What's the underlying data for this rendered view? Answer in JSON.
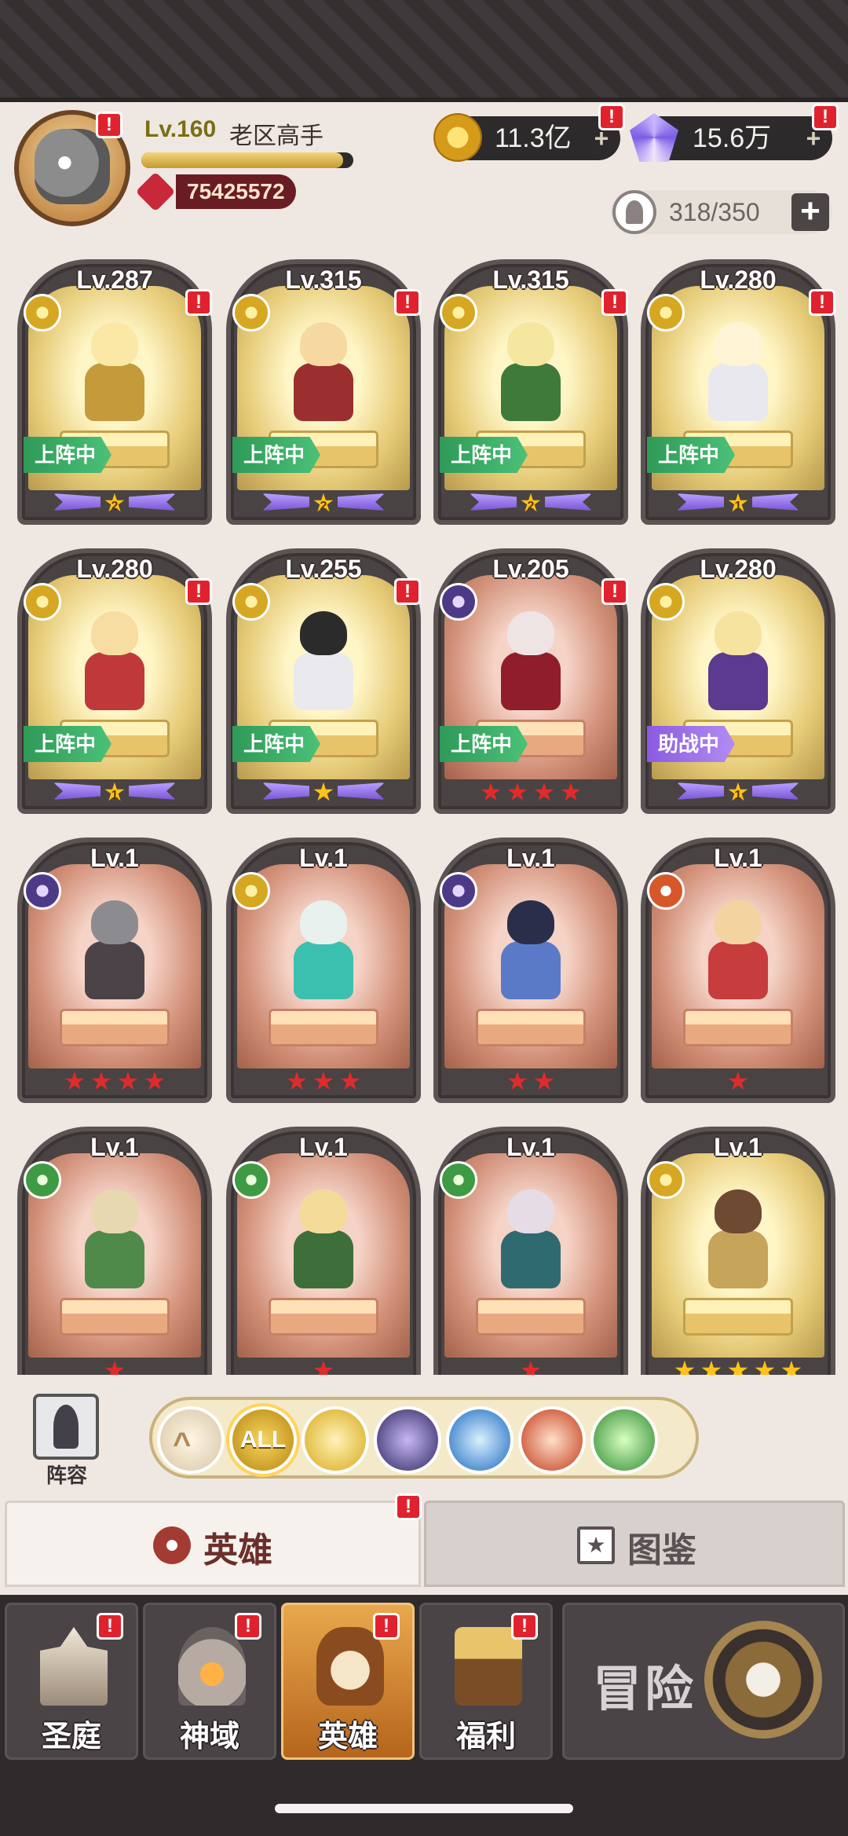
{
  "header": {
    "level": "Lv.160",
    "name": "老区高手",
    "exp_fraction": 0.95,
    "power": "75425572",
    "gold": "11.3亿",
    "gems": "15.6万",
    "capacity": "318/350",
    "avatar_badge": "!",
    "gold_badge": "!",
    "gem_badge": "!"
  },
  "heroes": [
    {
      "level": "Lv.287",
      "faction": "gold",
      "bg": "gold",
      "tag": "上阵中",
      "tag_color": "green",
      "stars": 1,
      "star_num": "2",
      "star_style": "wing",
      "badge": "!"
    },
    {
      "level": "Lv.315",
      "faction": "gold",
      "bg": "gold",
      "tag": "上阵中",
      "tag_color": "green",
      "stars": 1,
      "star_num": "2",
      "star_style": "wing",
      "badge": "!"
    },
    {
      "level": "Lv.315",
      "faction": "gold",
      "bg": "gold",
      "tag": "上阵中",
      "tag_color": "green",
      "stars": 1,
      "star_num": "2",
      "star_style": "wing",
      "badge": "!"
    },
    {
      "level": "Lv.280",
      "faction": "gold",
      "bg": "gold",
      "tag": "上阵中",
      "tag_color": "green",
      "stars": 1,
      "star_num": "1",
      "star_style": "wing",
      "badge": "!"
    },
    {
      "level": "Lv.280",
      "faction": "gold",
      "bg": "gold",
      "tag": "上阵中",
      "tag_color": "green",
      "stars": 1,
      "star_num": "1",
      "star_style": "wing",
      "badge": "!"
    },
    {
      "level": "Lv.255",
      "faction": "gold",
      "bg": "gold",
      "tag": "上阵中",
      "tag_color": "green",
      "stars": 1,
      "star_num": "",
      "star_style": "wing",
      "badge": "!"
    },
    {
      "level": "Lv.205",
      "faction": "dark",
      "bg": "red",
      "tag": "上阵中",
      "tag_color": "green",
      "stars": 4,
      "star_num": "",
      "star_style": "red",
      "badge": "!"
    },
    {
      "level": "Lv.280",
      "faction": "gold",
      "bg": "gold",
      "tag": "助战中",
      "tag_color": "purple",
      "stars": 1,
      "star_num": "1",
      "star_style": "wing",
      "badge": ""
    },
    {
      "level": "Lv.1",
      "faction": "dark",
      "bg": "red",
      "tag": "",
      "tag_color": "",
      "stars": 4,
      "star_num": "",
      "star_style": "red",
      "badge": ""
    },
    {
      "level": "Lv.1",
      "faction": "gold",
      "bg": "red",
      "tag": "",
      "tag_color": "",
      "stars": 3,
      "star_num": "",
      "star_style": "red",
      "badge": ""
    },
    {
      "level": "Lv.1",
      "faction": "dark",
      "bg": "red",
      "tag": "",
      "tag_color": "",
      "stars": 2,
      "star_num": "",
      "star_style": "red",
      "badge": ""
    },
    {
      "level": "Lv.1",
      "faction": "fox",
      "bg": "red",
      "tag": "",
      "tag_color": "",
      "stars": 1,
      "star_num": "",
      "star_style": "red",
      "badge": ""
    },
    {
      "level": "Lv.1",
      "faction": "nature",
      "bg": "red",
      "tag": "",
      "tag_color": "",
      "stars": 1,
      "star_num": "",
      "star_style": "red",
      "badge": ""
    },
    {
      "level": "Lv.1",
      "faction": "nature",
      "bg": "red",
      "tag": "",
      "tag_color": "",
      "stars": 1,
      "star_num": "",
      "star_style": "red",
      "badge": ""
    },
    {
      "level": "Lv.1",
      "faction": "nature",
      "bg": "red",
      "tag": "",
      "tag_color": "",
      "stars": 1,
      "star_num": "",
      "star_style": "red",
      "badge": ""
    },
    {
      "level": "Lv.1",
      "faction": "gold",
      "bg": "gold",
      "tag": "",
      "tag_color": "",
      "stars": 5,
      "star_num": "",
      "star_style": "gold",
      "badge": ""
    }
  ],
  "filters": {
    "lineup_label": "阵容",
    "all_label": "ALL",
    "up_icon": "^",
    "items": [
      "sort-up-icon",
      "all",
      "holy-faction-icon",
      "dark-faction-icon",
      "cross-faction-icon",
      "fox-faction-icon",
      "nature-faction-icon"
    ]
  },
  "tabs": {
    "heroes": "英雄",
    "codex": "图鉴",
    "codex_icon": "★",
    "heroes_badge": "!"
  },
  "bottom_nav": {
    "court": "圣庭",
    "divine": "神域",
    "heroes": "英雄",
    "welfare": "福利",
    "adventure": "冒险",
    "badge": "!"
  }
}
